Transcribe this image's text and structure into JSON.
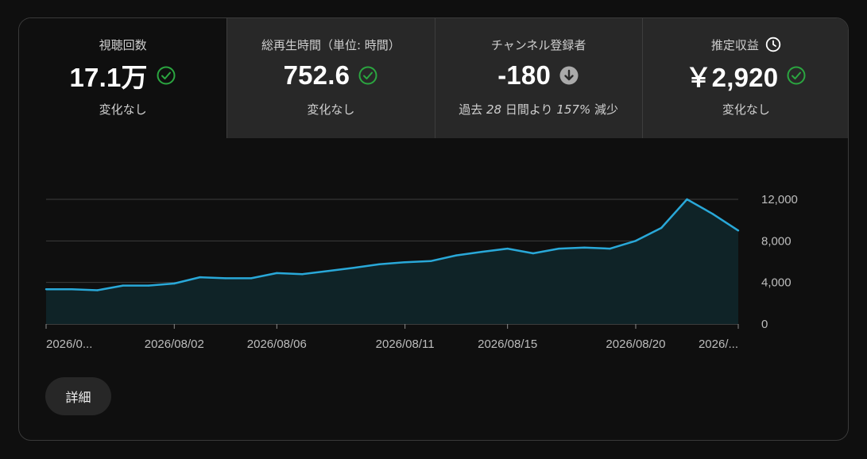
{
  "metrics": [
    {
      "title": "視聴回数",
      "value": "17.1万",
      "status_icon": "check-circle-icon",
      "status_color": "#2ba640",
      "sub": "変化なし",
      "selected": true
    },
    {
      "title": "総再生時間（単位: 時間）",
      "value": "752.6",
      "status_icon": "check-circle-icon",
      "status_color": "#2ba640",
      "sub": "変化なし",
      "selected": false
    },
    {
      "title": "チャンネル登録者",
      "value": "-180",
      "status_icon": "arrow-down-circle-icon",
      "status_color": "#aaaaaa",
      "sub_prefix": "過去 ",
      "sub_days": "28",
      "sub_mid": " 日間より ",
      "sub_pct": "157%",
      "sub_suffix": " 減少",
      "selected": false
    },
    {
      "title": "推定収益",
      "title_icon": "clock-icon",
      "value": "￥2,920",
      "status_icon": "check-circle-icon",
      "status_color": "#2ba640",
      "sub": "変化なし",
      "selected": false
    }
  ],
  "chart_data": {
    "type": "area",
    "line_color": "#29a8d8",
    "fill_color": "#0f2327",
    "y_ticks": [
      "12,000",
      "8,000",
      "4,000",
      "0"
    ],
    "ylim": [
      0,
      12000
    ],
    "grid": true,
    "x_tick_labels": [
      "2026/0...",
      "2026/08/02",
      "2026/08/06",
      "2026/08/11",
      "2026/08/15",
      "2026/08/20",
      "2026/..."
    ],
    "x_tick_index": [
      0,
      5,
      9,
      14,
      18,
      23,
      27
    ],
    "x": [
      "2026/07/28",
      "2026/07/29",
      "2026/07/30",
      "2026/07/31",
      "2026/08/01",
      "2026/08/02",
      "2026/08/03",
      "2026/08/04",
      "2026/08/05",
      "2026/08/06",
      "2026/08/07",
      "2026/08/08",
      "2026/08/09",
      "2026/08/10",
      "2026/08/11",
      "2026/08/12",
      "2026/08/13",
      "2026/08/14",
      "2026/08/15",
      "2026/08/16",
      "2026/08/17",
      "2026/08/18",
      "2026/08/19",
      "2026/08/20",
      "2026/08/21",
      "2026/08/22",
      "2026/08/23",
      "2026/08/24"
    ],
    "values": [
      3350,
      3350,
      3250,
      3700,
      3700,
      3900,
      4500,
      4400,
      4400,
      4900,
      4800,
      5100,
      5400,
      5750,
      5950,
      6050,
      6600,
      6950,
      7250,
      6800,
      7250,
      7350,
      7250,
      8000,
      9250,
      12000,
      10600,
      9000
    ]
  },
  "details_button": "詳細"
}
